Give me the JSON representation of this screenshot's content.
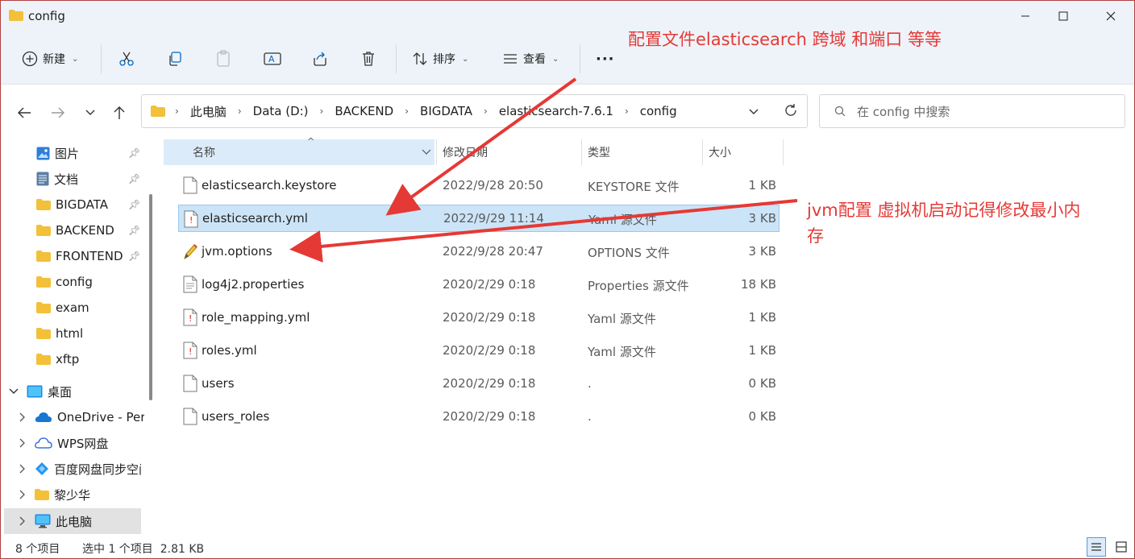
{
  "window": {
    "title": "config",
    "accent": "#0067c0",
    "annotation_color": "#e53935"
  },
  "toolbar": {
    "new_label": "新建",
    "sort_label": "排序",
    "view_label": "查看",
    "more_label": "···"
  },
  "address": {
    "crumbs": [
      "此电脑",
      "Data (D:)",
      "BACKEND",
      "BIGDATA",
      "elasticsearch-7.6.1",
      "config"
    ]
  },
  "search": {
    "placeholder": "在 config 中搜索"
  },
  "sidebar": {
    "items": [
      {
        "label": "图片",
        "pinned": true
      },
      {
        "label": "文档",
        "pinned": true
      },
      {
        "label": "BIGDATA",
        "pinned": true
      },
      {
        "label": "BACKEND",
        "pinned": true
      },
      {
        "label": "FRONTEND",
        "pinned": true
      },
      {
        "label": "config"
      },
      {
        "label": "exam"
      },
      {
        "label": "html"
      },
      {
        "label": "xftp"
      },
      {
        "label": "桌面"
      },
      {
        "label": "OneDrive - Pers"
      },
      {
        "label": "WPS网盘"
      },
      {
        "label": "百度网盘同步空间"
      },
      {
        "label": "黎少华"
      },
      {
        "label": "此电脑"
      }
    ]
  },
  "columns": {
    "name": "名称",
    "modified": "修改日期",
    "type": "类型",
    "size": "大小"
  },
  "files": [
    {
      "name": "elasticsearch.keystore",
      "modified": "2022/9/28 20:50",
      "type": "KEYSTORE 文件",
      "size": "1 KB"
    },
    {
      "name": "elasticsearch.yml",
      "modified": "2022/9/29 11:14",
      "type": "Yaml 源文件",
      "size": "3 KB"
    },
    {
      "name": "jvm.options",
      "modified": "2022/9/28 20:47",
      "type": "OPTIONS 文件",
      "size": "3 KB"
    },
    {
      "name": "log4j2.properties",
      "modified": "2020/2/29 0:18",
      "type": "Properties 源文件",
      "size": "18 KB"
    },
    {
      "name": "role_mapping.yml",
      "modified": "2020/2/29 0:18",
      "type": "Yaml 源文件",
      "size": "1 KB"
    },
    {
      "name": "roles.yml",
      "modified": "2020/2/29 0:18",
      "type": "Yaml 源文件",
      "size": "1 KB"
    },
    {
      "name": "users",
      "modified": "2020/2/29 0:18",
      "type": ".",
      "size": "0 KB"
    },
    {
      "name": "users_roles",
      "modified": "2020/2/29 0:18",
      "type": ".",
      "size": "0 KB"
    }
  ],
  "status": {
    "count": "8 个项目",
    "selection": "选中 1 个项目  2.81 KB"
  },
  "annotations": {
    "top": "配置文件elasticsearch 跨域 和端口 等等",
    "right_line1": "jvm配置  虚拟机启动记得修改最小内",
    "right_line2": "存"
  }
}
